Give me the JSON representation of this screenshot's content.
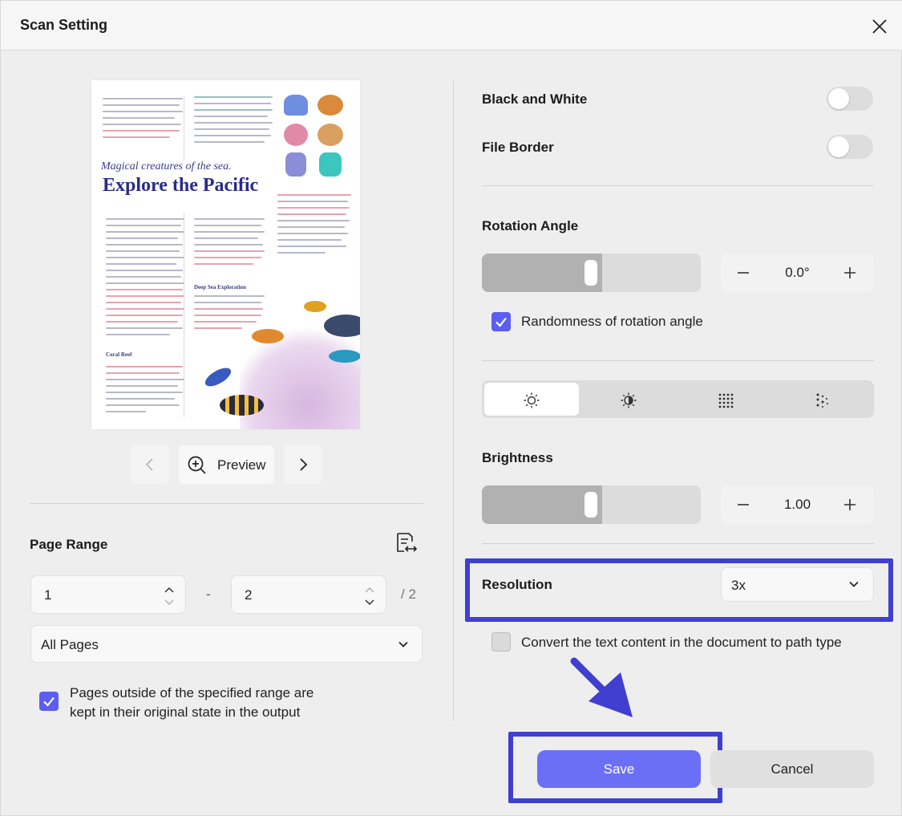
{
  "dialog": {
    "title": "Scan Setting"
  },
  "preview": {
    "doc_subtitle": "Magical creatures of the sea.",
    "doc_title": "Explore the Pacific",
    "doc_heading_deep_sea": "Deep Sea Exploration",
    "doc_heading_coral": "Coral Reef",
    "preview_label": "Preview"
  },
  "page_range": {
    "label": "Page Range",
    "from": "1",
    "separator": "-",
    "to": "2",
    "total": "/ 2",
    "scope_value": "All Pages",
    "keep_outside_checked": true,
    "keep_outside_line1": "Pages outside of the specified range are",
    "keep_outside_line2": "kept in their original state in the output"
  },
  "settings": {
    "black_white_label": "Black and White",
    "black_white_on": false,
    "file_border_label": "File Border",
    "file_border_on": false,
    "rotation_label": "Rotation Angle",
    "rotation_value": "0.0°",
    "rotation_slider_fraction": 0.5,
    "randomness_checked": true,
    "randomness_label": "Randomness of rotation angle",
    "adjust_tabs": [
      "brightness-icon",
      "contrast-icon",
      "sharpness-icon",
      "noise-icon"
    ],
    "adjust_selected": "brightness-icon",
    "brightness_label": "Brightness",
    "brightness_value": "1.00",
    "brightness_slider_fraction": 0.5,
    "resolution_label": "Resolution",
    "resolution_value": "3x",
    "convert_path_checked": false,
    "convert_path_label": "Convert the text content in the document to path type"
  },
  "footer": {
    "save_label": "Save",
    "cancel_label": "Cancel"
  },
  "colors": {
    "accent": "#6b6ff5",
    "highlight": "#3f3fd0",
    "checkbox": "#5b5ef0"
  }
}
